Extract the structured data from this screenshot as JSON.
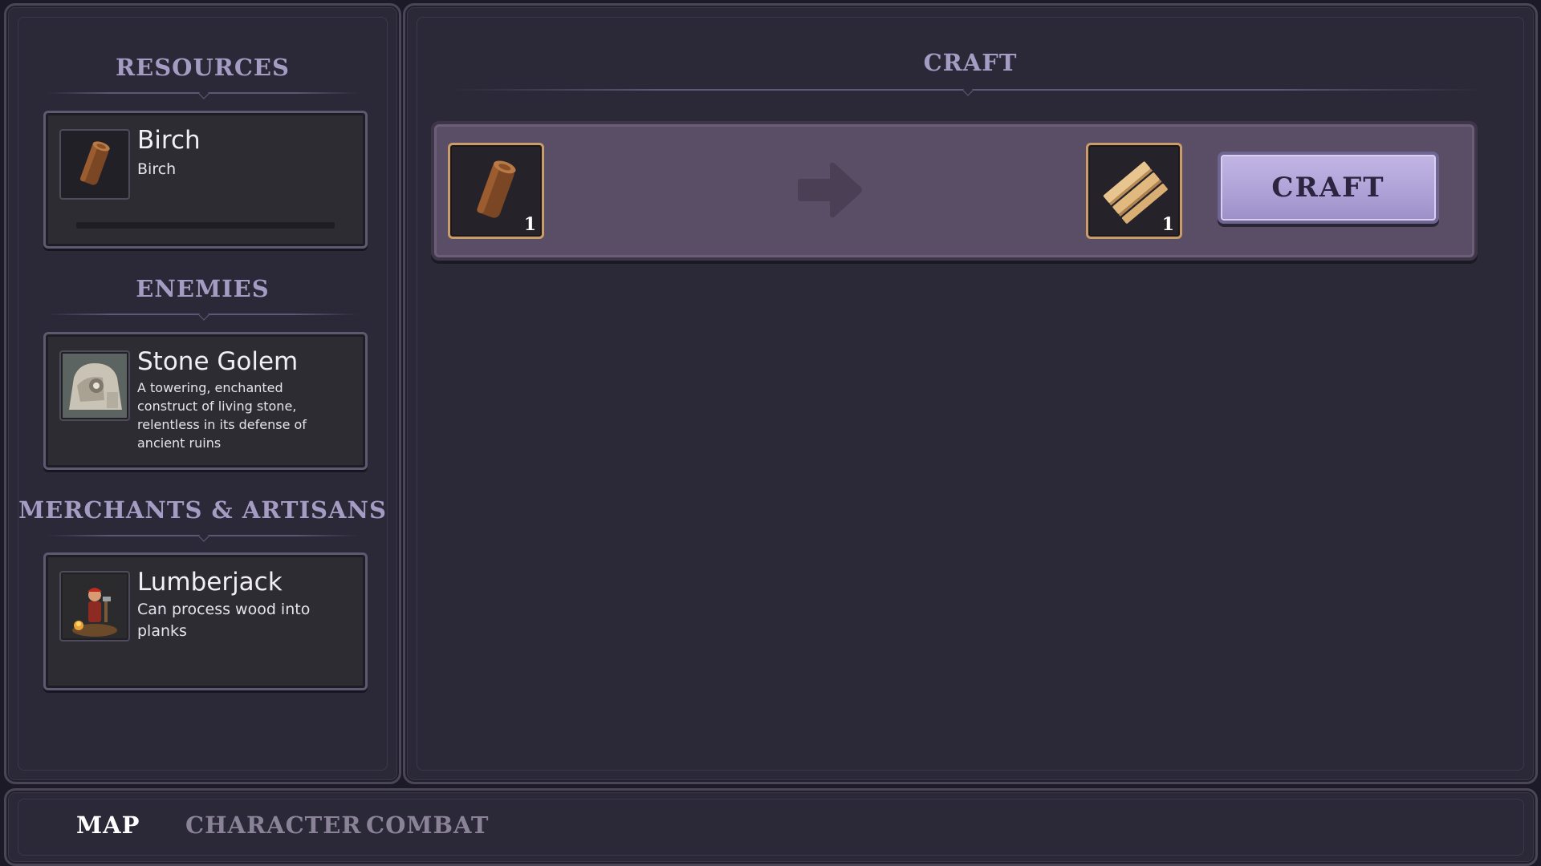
{
  "sidebar": {
    "resources": {
      "title": "RESOURCES",
      "item": {
        "name": "Birch",
        "subtitle": "Birch",
        "icon": "wood-log-icon",
        "progress": 0
      }
    },
    "enemies": {
      "title": "ENEMIES",
      "item": {
        "name": "Stone Golem",
        "description": "A towering, enchanted construct of living stone, relentless in its defense of ancient ruins",
        "icon": "stone-golem-portrait"
      }
    },
    "merchants": {
      "title": "MERCHANTS & ARTISANS",
      "item": {
        "name": "Lumberjack",
        "description": "Can process wood into planks",
        "icon": "lumberjack-portrait"
      }
    }
  },
  "craft_panel": {
    "title": "CRAFT",
    "recipe": {
      "input": {
        "icon": "wood-log-icon",
        "quantity": "1"
      },
      "arrow_icon": "arrow-right-icon",
      "output": {
        "icon": "wood-planks-icon",
        "quantity": "1"
      },
      "button_label": "CRAFT"
    }
  },
  "bottom_nav": {
    "items": [
      {
        "label": "MAP",
        "active": true
      },
      {
        "label": "CHARACTER",
        "active": false
      },
      {
        "label": "COMBAT",
        "active": false
      }
    ]
  },
  "colors": {
    "accent": "#a49cc2",
    "slot_border": "#c99c6a",
    "button": "#ada0d6"
  }
}
